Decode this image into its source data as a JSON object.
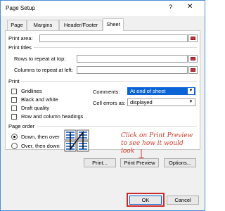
{
  "window": {
    "title": "Page Setup",
    "help": "?",
    "close": "✕"
  },
  "tabs": [
    {
      "label": "Page"
    },
    {
      "label": "Margins"
    },
    {
      "label": "Header/Footer"
    },
    {
      "label": "Sheet",
      "active": true
    }
  ],
  "print_area": {
    "label": "Print area:",
    "value": ""
  },
  "print_titles": {
    "heading": "Print titles",
    "rows_label": "Rows to repeat at top:",
    "cols_label": "Columns to repeat at left:"
  },
  "print": {
    "heading": "Print",
    "options": [
      {
        "label": "Gridlines",
        "checked": false
      },
      {
        "label": "Black and white",
        "checked": false
      },
      {
        "label": "Draft quality",
        "checked": false
      },
      {
        "label": "Row and column headings",
        "checked": false
      }
    ],
    "comments_label": "Comments:",
    "comments_value": "At end of sheet",
    "cell_errors_label": "Cell errors as:",
    "cell_errors_value": "displayed"
  },
  "page_order": {
    "heading": "Page order",
    "options": [
      {
        "label": "Down, then over",
        "selected": true
      },
      {
        "label": "Over, then down",
        "selected": false
      }
    ]
  },
  "annotation": {
    "text": "Click on Print Preview to see how it would look"
  },
  "buttons": {
    "print": "Print...",
    "print_preview": "Print Preview",
    "options": "Options...",
    "ok": "OK",
    "cancel": "Cancel"
  },
  "colors": {
    "annotation": "#d23a2b",
    "highlight": "#0a64d6",
    "ok_outline": "#cc2a2a"
  }
}
